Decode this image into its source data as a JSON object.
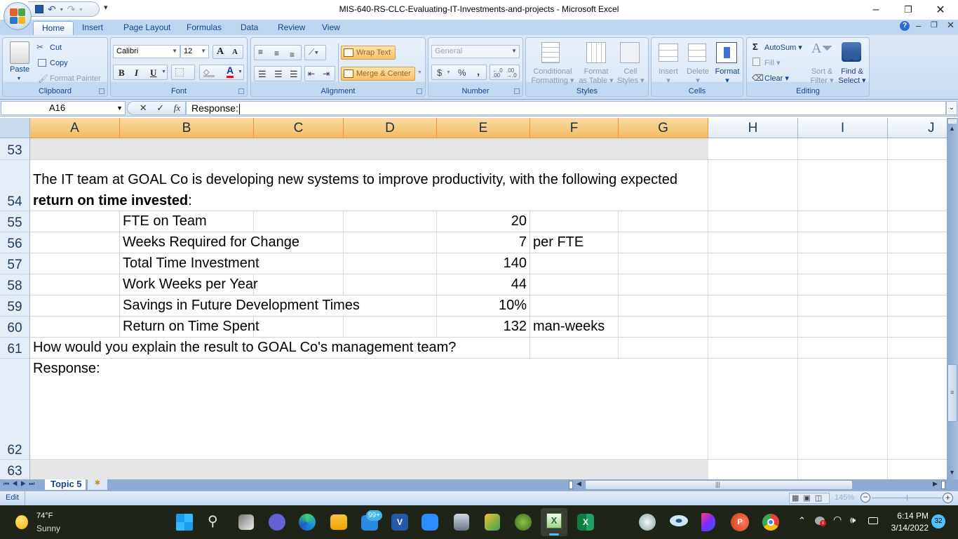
{
  "window": {
    "title": "MIS-640-RS-CLC-Evaluating-IT-Investments-and-projects - Microsoft Excel",
    "controls": {
      "minimize": "–",
      "restore": "❐",
      "close": "✕"
    }
  },
  "ribbon": {
    "tabs": [
      {
        "label": "Home",
        "active": true
      },
      {
        "label": "Insert"
      },
      {
        "label": "Page Layout"
      },
      {
        "label": "Formulas"
      },
      {
        "label": "Data"
      },
      {
        "label": "Review"
      },
      {
        "label": "View"
      }
    ],
    "clipboard": {
      "label": "Clipboard",
      "paste": "Paste",
      "cut": "Cut",
      "copy": "Copy",
      "format_painter": "Format Painter"
    },
    "font": {
      "label": "Font",
      "font_name": "Calibri",
      "font_size": "12",
      "bold": "B",
      "italic": "I",
      "underline": "U",
      "grow": "A",
      "shrink": "A",
      "font_color_hex": "#ff0000"
    },
    "alignment": {
      "label": "Alignment",
      "wrap_text": "Wrap Text",
      "merge_center": "Merge & Center"
    },
    "number": {
      "label": "Number",
      "format": "General",
      "currency": "$",
      "percent": "%",
      "comma": ",",
      "inc_decimal": "←.0 .00",
      "dec_decimal": ".00 →.0"
    },
    "styles": {
      "label": "Styles",
      "conditional_formatting": [
        "Conditional",
        "Formatting"
      ],
      "format_as_table": [
        "Format",
        "as Table"
      ],
      "cell_styles": [
        "Cell",
        "Styles"
      ]
    },
    "cells": {
      "label": "Cells",
      "insert": "Insert",
      "delete": "Delete",
      "format": "Format"
    },
    "editing": {
      "label": "Editing",
      "autosum": "AutoSum",
      "fill": "Fill",
      "clear": "Clear",
      "sort_filter": [
        "Sort &",
        "Filter"
      ],
      "find_select": [
        "Find &",
        "Select"
      ]
    }
  },
  "formula_bar": {
    "name_box": "A16",
    "fx": "fx",
    "cancel": "✕",
    "enter": "✓",
    "content": "Response:"
  },
  "columns": [
    "A",
    "B",
    "C",
    "D",
    "E",
    "F",
    "G",
    "H",
    "I",
    "J"
  ],
  "rows": [
    {
      "num": "53"
    },
    {
      "num": "54",
      "text_line1": "The IT team at GOAL Co is developing new systems to improve productivity, with the following expected",
      "text_bold": "return on time invested",
      "text_tail": ":"
    },
    {
      "num": "55",
      "label": "FTE on Team",
      "value": "20",
      "unit": ""
    },
    {
      "num": "56",
      "label": "Weeks Required for Change",
      "value": "7",
      "unit": "per FTE"
    },
    {
      "num": "57",
      "label": "Total Time Investment",
      "value": "140",
      "unit": ""
    },
    {
      "num": "58",
      "label": "Work Weeks per Year",
      "value": "44",
      "unit": ""
    },
    {
      "num": "59",
      "label": "Savings in Future Development Times",
      "value": "10%",
      "unit": ""
    },
    {
      "num": "60",
      "label": "Return on Time Spent",
      "value": "132",
      "unit": "man-weeks"
    },
    {
      "num": "61",
      "text": "How would you explain the result to GOAL Co's management team?"
    },
    {
      "num": "62",
      "text": "Response:"
    },
    {
      "num": "63"
    }
  ],
  "sheet_tabs": {
    "active": "Topic 5"
  },
  "status_bar": {
    "mode": "Edit",
    "zoom": "145%"
  },
  "taskbar": {
    "weather_temp": "74°F",
    "weather_desc": "Sunny",
    "mail_badge": "99+",
    "time": "6:14 PM",
    "date": "3/14/2022",
    "notification_count": "32"
  }
}
